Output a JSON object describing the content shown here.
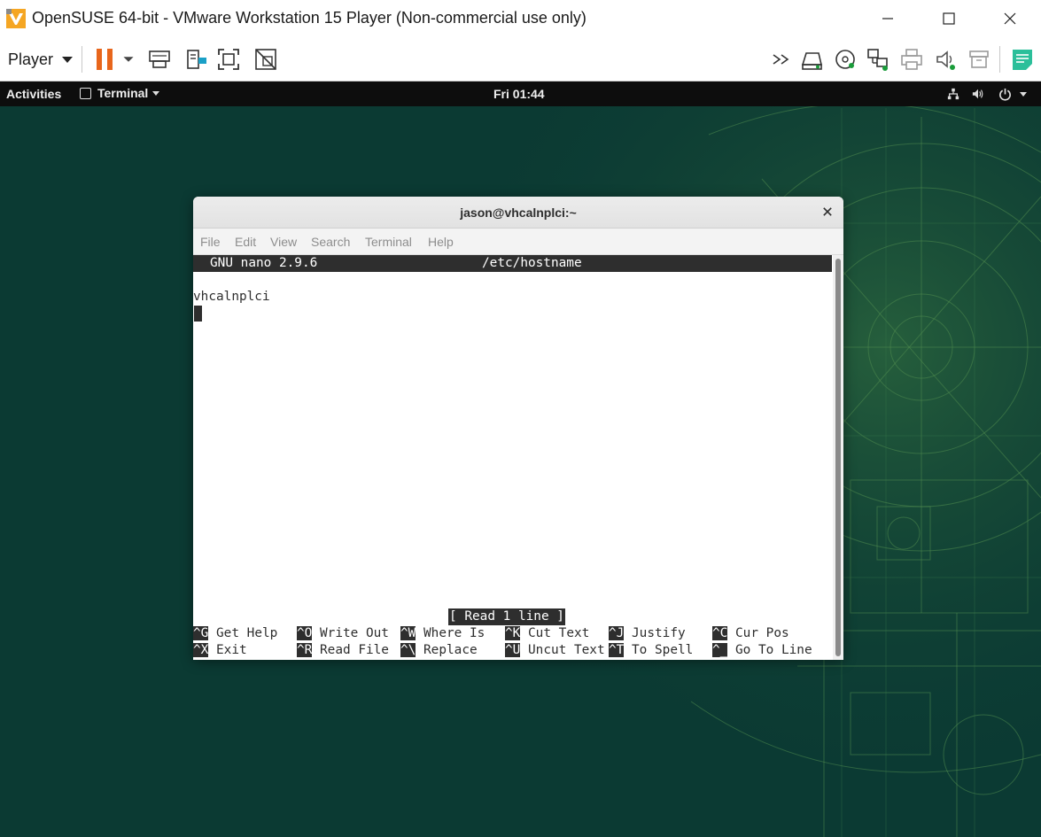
{
  "host_window": {
    "title": "OpenSUSE 64-bit - VMware Workstation 15 Player (Non-commercial use only)",
    "logo_icon": "vmware-player-logo",
    "controls": [
      "minimize-icon",
      "maximize-icon",
      "close-icon"
    ]
  },
  "player_toolbar": {
    "menu_label": "Player",
    "left_icons": [
      "pause-icon",
      "dropdown-caret-icon",
      "send-ctrl-alt-del-icon",
      "removable-devices-icon",
      "full-screen-icon",
      "unity-icon"
    ],
    "right_icons": [
      "more-devices-icon",
      "hard-disk-icon",
      "cd-dvd-icon",
      "network-adapter-icon",
      "printer-icon",
      "sound-card-icon",
      "usb-controller-icon",
      "message-log-icon"
    ],
    "accent_color": "#e8661c"
  },
  "gnome_bar": {
    "activities": "Activities",
    "app_menu": "Terminal",
    "clock": "Fri 01:44",
    "tray_icons": [
      "network-wired-icon",
      "volume-icon",
      "power-icon",
      "system-menu-caret-icon"
    ]
  },
  "terminal": {
    "title": "jason@vhcalnplci:~",
    "menu": [
      "File",
      "Edit",
      "View",
      "Search",
      "Terminal",
      "Help"
    ],
    "nano": {
      "version": "GNU nano 2.9.6",
      "filename": "/etc/hostname",
      "content_line": "vhcalnplci",
      "status": "[ Read 1 line ]",
      "shortcuts_row1": [
        {
          "key": "^G",
          "label": "Get Help"
        },
        {
          "key": "^O",
          "label": "Write Out"
        },
        {
          "key": "^W",
          "label": "Where Is"
        },
        {
          "key": "^K",
          "label": "Cut Text"
        },
        {
          "key": "^J",
          "label": "Justify"
        },
        {
          "key": "^C",
          "label": "Cur Pos"
        }
      ],
      "shortcuts_row2": [
        {
          "key": "^X",
          "label": "Exit"
        },
        {
          "key": "^R",
          "label": "Read File"
        },
        {
          "key": "^\\",
          "label": "Replace"
        },
        {
          "key": "^U",
          "label": "Uncut Text"
        },
        {
          "key": "^T",
          "label": "To Spell"
        },
        {
          "key": "^_",
          "label": "Go To Line"
        }
      ]
    }
  }
}
